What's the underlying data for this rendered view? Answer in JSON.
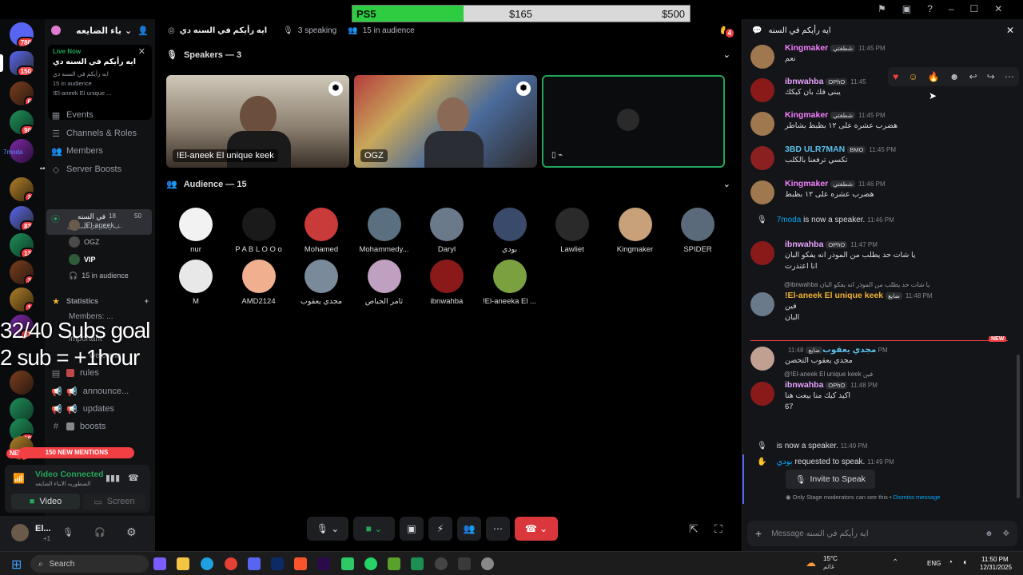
{
  "window": {
    "title_bar_icons": [
      "inbox-icon",
      "screen-icon",
      "help-icon"
    ],
    "controls": [
      "minimize",
      "maximize",
      "close"
    ]
  },
  "goal_bar": {
    "label": "PS5",
    "current": "$165",
    "target": "$500",
    "progress_fraction": 0.33
  },
  "overlay": {
    "line1": "32/40 Subs goal",
    "line2": "2 sub = +1hour"
  },
  "rail": {
    "top_badge": "780",
    "badges": [
      "150",
      "6",
      "90",
      "2",
      "83",
      "13",
      "3",
      "1",
      "67",
      "10",
      "89",
      "NEW"
    ],
    "stream_label": "7moda",
    "stream_text": "باء الضايعه"
  },
  "server": {
    "name": "باء الضايعه"
  },
  "live_card": {
    "status": "Live Now",
    "title": "ايه رأيكم في السنه دي",
    "channel": "ايه رأيكم في السنه دي",
    "audience": "15 in audience",
    "speaker": "!El-aneek El unique ..."
  },
  "channels": {
    "events": "Events",
    "channels_roles": "Channels & Roles",
    "members": "Members",
    "server_boosts": "Server Boosts",
    "stage_name": "في السنه",
    "stage_sub": "ايه رأيكم في السنه دي",
    "stage_count": "18",
    "stage_limit": "50",
    "stage_users": [
      "!El-aneek ...",
      "OGZ",
      "VIP"
    ],
    "stage_audience": "15 in audience",
    "category": "Statistics",
    "stat_members": "Members: ...",
    "important": "important",
    "welcome": "welcome",
    "rules": "rules",
    "announce": "announce...",
    "updates": "updates",
    "boosts": "boosts"
  },
  "mentions": "150 NEW MENTIONS",
  "voice": {
    "status": "Video Connected",
    "server": "الضطوريه الأبناء الضايعه",
    "video_btn": "Video",
    "screen_btn": "Screen"
  },
  "user": {
    "name": "El...",
    "status": "+1"
  },
  "stage": {
    "title": "ايه رأيكم في السنه دي",
    "speaking": "3 speaking",
    "audience_count": "15 in audience",
    "hands_badge": "4",
    "speakers_label": "Speakers — 3",
    "audience_label": "Audience — 15",
    "tiles": [
      "!El-aneek El unique keek",
      "OGZ",
      ""
    ],
    "audience": [
      "nur",
      "P A B L O O o",
      "Mohamed",
      "Mohammedy...",
      "Daryl",
      "بودي",
      "Lawliet",
      "Kingmaker",
      "SPIDER",
      "M",
      "AMD2124",
      "مجدي يعقوب",
      "ثامر الجباص",
      "ibnwahba",
      "!El-aneeka El ..."
    ]
  },
  "chat": {
    "title": "ايه رأيكم في السنه",
    "messages": [
      {
        "name": "Kingmaker",
        "role": "شطفتي",
        "time": "11:45 PM",
        "text": "نعم",
        "color": "#f47fff"
      },
      {
        "name": "ibnwahba",
        "role": "OPhO",
        "time": "11:45",
        "text": "يبنى فك بان كيكك",
        "color": "#e8a2ff"
      },
      {
        "name": "Kingmaker",
        "role": "شطفتي",
        "time": "11:45 PM",
        "text": "هضرب عشره على ١٢ بظبط بشاطر",
        "color": "#f47fff"
      },
      {
        "name": "3BD ULR7MAN",
        "role": "BMO",
        "time": "11:45 PM",
        "text": "تكسي ترفعنا بالكلب",
        "color": "#5bc0eb"
      },
      {
        "name": "Kingmaker",
        "role": "شطفتي",
        "time": "11:46 PM",
        "text": "هضرب عشره على ١٢ بظبط",
        "color": "#f47fff"
      },
      {
        "name": "ibnwahba",
        "role": "OPhO",
        "time": "11:47 PM",
        "text": "يا شات حد يطلب من الموذر انه يفكو البان",
        "text2": "انا اعتذرت",
        "color": "#e8a2ff"
      },
      {
        "name": "!El-aneek El unique keek",
        "role": "ضايع",
        "time": "11:48 PM",
        "text": "فين",
        "text2": "البان",
        "color": "#f0b232",
        "reply": "@ibnwahba  يا شات حد يطلب من الموذر انه يفكو البان"
      },
      {
        "name": "مجدي يعقوب",
        "role": "ضايع",
        "time": "11:48 PM",
        "text": "مجدي يعقوب التحصن",
        "color": "#5bc0eb"
      },
      {
        "name": "ibnwahba",
        "role": "OPhO",
        "time": "11:48 PM",
        "text": "اكيد كيك منا بيعت هنا",
        "text2": "67",
        "color": "#e8a2ff",
        "reply": "@!El-aneek El unique keek  فين"
      }
    ],
    "system1": {
      "name": "7moda",
      "text": "is now a speaker.",
      "time": "11:46 PM"
    },
    "system2": {
      "text": "is now a speaker.",
      "time": "11:49 PM"
    },
    "system3": {
      "name": "بودي",
      "text": "requested to speak.",
      "time": "11:49 PM"
    },
    "invite_btn": "Invite to Speak",
    "mod_note": "Only Stage moderators can see this •",
    "dismiss": "Dismiss message",
    "new_label": "NEW",
    "placeholder": "Message ايه رأيكم في السنه"
  },
  "taskbar": {
    "search": "Search",
    "weather_temp": "15°C",
    "weather_text": "غائم",
    "lang": "ENG",
    "time": "11:50 PM",
    "date": "12/31/2025"
  }
}
